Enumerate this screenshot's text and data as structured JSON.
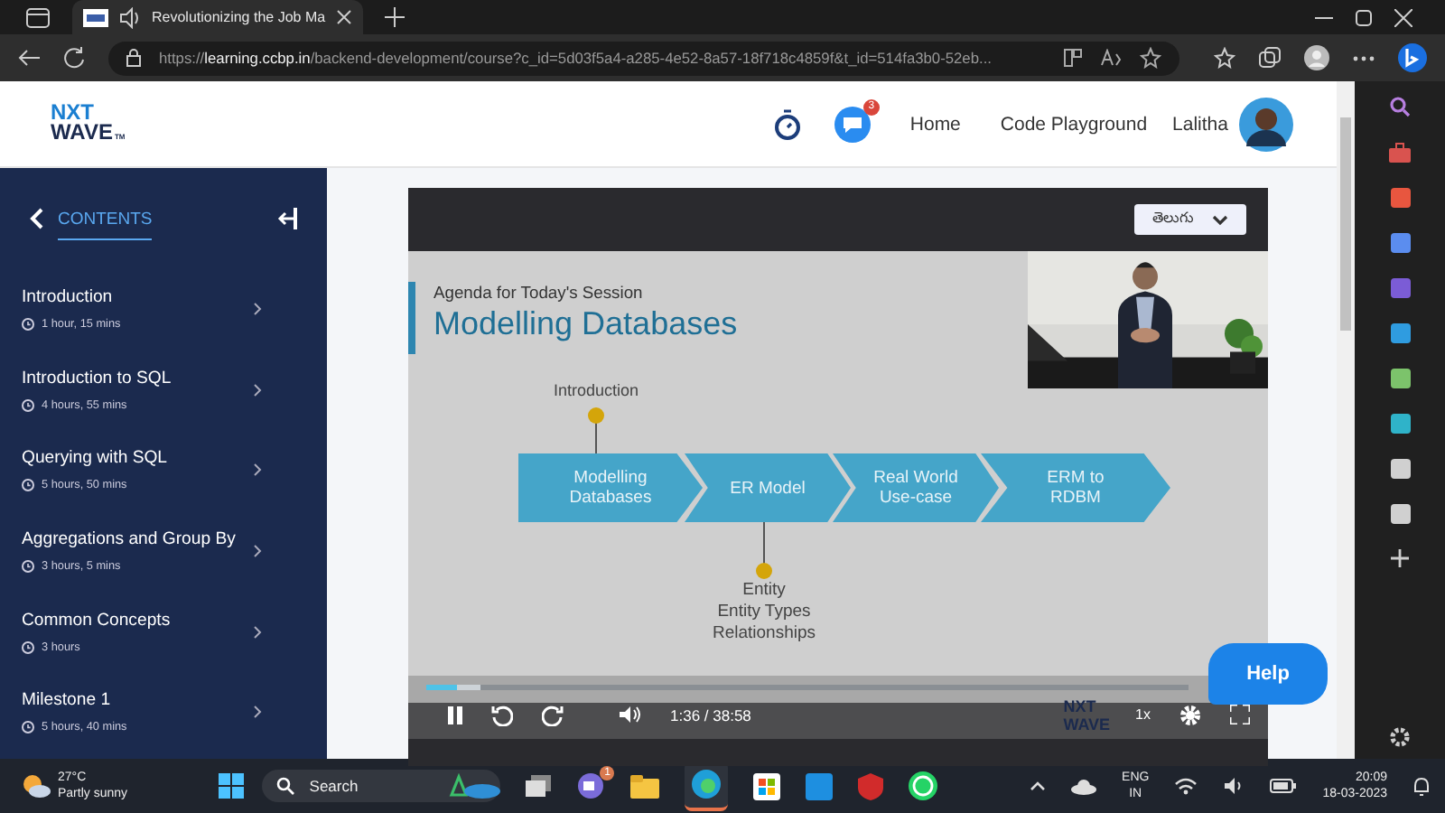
{
  "browser": {
    "tab_title": "Revolutionizing the Job Ma",
    "url": "https://**learning.ccbp.in**/backend-development/course?c_id=5d03f5a4-a285-4e52-8a57-18f718c4859f&t_id=514fa3b0-52eb..."
  },
  "header": {
    "logo_top": "NXT",
    "logo_bottom": "WAVE",
    "logo_tm": "TM",
    "chat_badge": "3",
    "nav": [
      "Home",
      "Code Playground"
    ],
    "user": "Lalitha"
  },
  "sidebar": {
    "title": "CONTENTS",
    "items": [
      {
        "title": "Introduction",
        "duration": "1 hour, 15 mins"
      },
      {
        "title": "Introduction to SQL",
        "duration": "4 hours, 55 mins"
      },
      {
        "title": "Querying with SQL",
        "duration": "5 hours, 50 mins"
      },
      {
        "title": "Aggregations and Group By",
        "duration": "3 hours, 5 mins"
      },
      {
        "title": "Common Concepts",
        "duration": "3 hours"
      },
      {
        "title": "Milestone 1",
        "duration": "5 hours, 40 mins"
      }
    ]
  },
  "video": {
    "language": "తెలుగు",
    "slide": {
      "subtitle": "Agenda for Today's Session",
      "title": "Modelling Databases",
      "top_label": "Introduction",
      "steps": [
        "Modelling Databases",
        "ER Model",
        "Real World Use-case",
        "ERM to RDBM"
      ],
      "bottom_labels": [
        "Entity",
        "Entity Types",
        "Relationships"
      ]
    },
    "progress": {
      "level": 0.04
    },
    "time": "1:36 / 38:58",
    "speed": "1x",
    "mark_top": "NXT",
    "mark_bottom": "WAVE"
  },
  "help": "Help",
  "taskbar": {
    "temperature": "27°C",
    "weather": "Partly sunny",
    "search": "Search",
    "teams_badge": "1",
    "language": "ENG",
    "region": "IN",
    "time": "20:09",
    "date": "18-03-2023"
  }
}
